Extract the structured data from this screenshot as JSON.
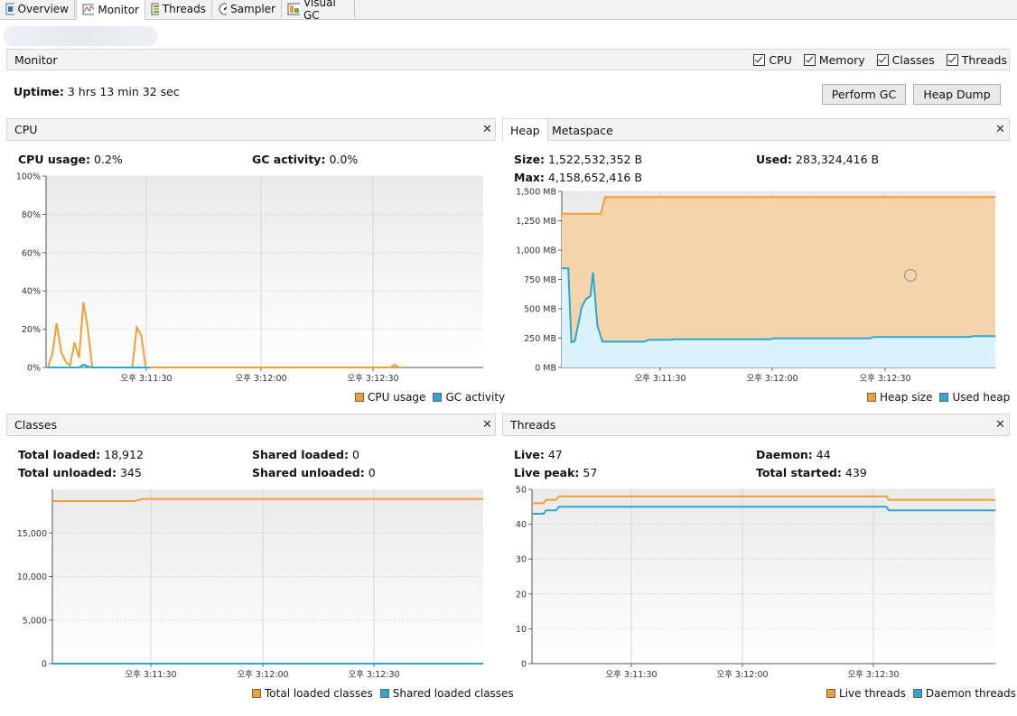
{
  "tabs": [
    {
      "label": "Overview",
      "icon": "overview-icon"
    },
    {
      "label": "Monitor",
      "icon": "monitor-icon"
    },
    {
      "label": "Threads",
      "icon": "threads-icon"
    },
    {
      "label": "Sampler",
      "icon": "sampler-icon"
    },
    {
      "label": "Visual GC",
      "icon": "visual-gc-icon"
    }
  ],
  "monitor": {
    "title": "Monitor",
    "checkboxes": [
      {
        "label": "CPU",
        "checked": true
      },
      {
        "label": "Memory",
        "checked": true
      },
      {
        "label": "Classes",
        "checked": true
      },
      {
        "label": "Threads",
        "checked": true
      }
    ],
    "uptime_label": "Uptime:",
    "uptime_value": "3 hrs 13 min 32 sec",
    "perform_gc": "Perform GC",
    "heap_dump": "Heap Dump"
  },
  "cpu": {
    "title": "CPU",
    "usage_label": "CPU usage:",
    "usage_value": "0.2%",
    "gc_label": "GC activity:",
    "gc_value": "0.0%",
    "legend": [
      "CPU usage",
      "GC activity"
    ]
  },
  "heap": {
    "tab_heap": "Heap",
    "tab_meta": "Metaspace",
    "size_label": "Size:",
    "size_value": "1,522,532,352 B",
    "used_label": "Used:",
    "used_value": "283,324,416 B",
    "max_label": "Max:",
    "max_value": "4,158,652,416 B",
    "legend": [
      "Heap size",
      "Used heap"
    ]
  },
  "classes": {
    "title": "Classes",
    "total_loaded_label": "Total loaded:",
    "total_loaded_value": "18,912",
    "total_unloaded_label": "Total unloaded:",
    "total_unloaded_value": "345",
    "shared_loaded_label": "Shared loaded:",
    "shared_loaded_value": "0",
    "shared_unloaded_label": "Shared unloaded:",
    "shared_unloaded_value": "0",
    "legend": [
      "Total loaded classes",
      "Shared loaded classes"
    ]
  },
  "threads": {
    "title": "Threads",
    "live_label": "Live:",
    "live_value": "47",
    "daemon_label": "Daemon:",
    "daemon_value": "44",
    "peak_label": "Live peak:",
    "peak_value": "57",
    "started_label": "Total started:",
    "started_value": "439",
    "legend": [
      "Live threads",
      "Daemon threads"
    ]
  },
  "colors": {
    "orange": "#f0a030",
    "blue": "#2aa8d0",
    "orange_fill": "#f6d2a8",
    "blue_fill": "#d9f2fb"
  },
  "chart_data": [
    {
      "type": "line",
      "name": "CPU",
      "x_ticks": [
        "오후 3:11:30",
        "오후 3:12:00",
        "오후 3:12:30"
      ],
      "y_ticks": [
        "100%",
        "80%",
        "60%",
        "40%",
        "20%",
        "0%"
      ],
      "ylim": [
        0,
        100
      ],
      "series": [
        {
          "name": "CPU usage",
          "color": "#f0a030",
          "values": [
            0,
            7,
            23,
            8,
            3,
            1,
            13,
            5,
            34,
            20,
            0,
            0,
            0,
            0,
            0,
            0,
            0,
            0,
            0,
            0,
            21,
            17,
            0,
            0,
            0,
            0,
            0,
            0,
            0,
            0,
            0,
            0,
            0,
            0,
            0,
            0,
            0,
            0,
            0,
            0,
            0,
            0,
            0,
            0,
            0,
            0,
            0,
            0,
            0,
            0,
            0,
            0,
            0,
            0,
            0,
            0,
            0,
            0,
            0,
            0,
            0,
            0,
            0,
            0,
            0,
            0,
            0,
            0,
            0,
            0,
            0,
            0,
            0,
            0,
            0,
            0,
            0,
            0,
            1.5,
            0,
            0
          ]
        },
        {
          "name": "GC activity",
          "color": "#2aa8d0",
          "values": [
            0,
            0,
            0,
            0,
            0,
            0,
            0,
            0,
            1.5,
            0.5,
            0,
            0,
            0,
            0,
            0,
            0,
            0,
            0,
            0,
            0,
            0,
            0,
            0,
            0
          ]
        }
      ]
    },
    {
      "type": "area",
      "name": "Heap",
      "x_ticks": [
        "오후 3:11:30",
        "오후 3:12:00",
        "오후 3:12:30"
      ],
      "y_ticks": [
        "1,500 MB",
        "1,250 MB",
        "1,000 MB",
        "750 MB",
        "500 MB",
        "250 MB",
        "0 MB"
      ],
      "ylim": [
        0,
        1500
      ],
      "series": [
        {
          "name": "Heap size",
          "color": "#f0a030",
          "points": [
            [
              0,
              1310
            ],
            [
              9,
              1310
            ],
            [
              10,
              1452
            ],
            [
              100,
              1452
            ]
          ]
        },
        {
          "name": "Used heap",
          "color": "#2aa8d0",
          "points": [
            [
              0,
              845
            ],
            [
              1.5,
              845
            ],
            [
              2.2,
              215
            ],
            [
              3,
              225
            ],
            [
              4.6,
              515
            ],
            [
              5.6,
              585
            ],
            [
              6.6,
              608
            ],
            [
              7.2,
              810
            ],
            [
              8.2,
              355
            ],
            [
              9.4,
              220
            ],
            [
              19,
              220
            ],
            [
              20,
              235
            ],
            [
              25,
              235
            ],
            [
              26,
              240
            ],
            [
              48,
              240
            ],
            [
              49,
              248
            ],
            [
              71,
              248
            ],
            [
              72,
              260
            ],
            [
              94,
              260
            ],
            [
              95,
              268
            ],
            [
              100,
              268
            ]
          ]
        }
      ]
    },
    {
      "type": "line",
      "name": "Classes",
      "x_ticks": [
        "오후 3:11:30",
        "오후 3:12:00",
        "오후 3:12:30"
      ],
      "y_ticks": [
        "15,000",
        "10,000",
        "5,000",
        "0"
      ],
      "ylim": [
        0,
        20000
      ],
      "series": [
        {
          "name": "Total loaded classes",
          "color": "#f0a030",
          "points": [
            [
              0,
              18650
            ],
            [
              19,
              18650
            ],
            [
              21,
              18900
            ],
            [
              100,
              18900
            ]
          ]
        },
        {
          "name": "Shared loaded classes",
          "color": "#2aa8d0",
          "points": [
            [
              0,
              0
            ],
            [
              100,
              0
            ]
          ]
        }
      ]
    },
    {
      "type": "line",
      "name": "Threads",
      "x_ticks": [
        "오후 3:11:30",
        "오후 3:12:00",
        "오후 3:12:30"
      ],
      "y_ticks": [
        "50",
        "40",
        "30",
        "20",
        "10",
        "0"
      ],
      "ylim": [
        0,
        50
      ],
      "series": [
        {
          "name": "Live threads",
          "color": "#f0a030",
          "points": [
            [
              0,
              46
            ],
            [
              2.5,
              46
            ],
            [
              3,
              47
            ],
            [
              5.2,
              47
            ],
            [
              5.8,
              48
            ],
            [
              76.5,
              48
            ],
            [
              77,
              47
            ],
            [
              100,
              47
            ]
          ]
        },
        {
          "name": "Daemon threads",
          "color": "#2aa8d0",
          "points": [
            [
              0,
              43
            ],
            [
              2.5,
              43
            ],
            [
              3,
              44
            ],
            [
              5.2,
              44
            ],
            [
              5.8,
              45
            ],
            [
              76.5,
              45
            ],
            [
              77,
              44
            ],
            [
              100,
              44
            ]
          ]
        }
      ]
    }
  ]
}
